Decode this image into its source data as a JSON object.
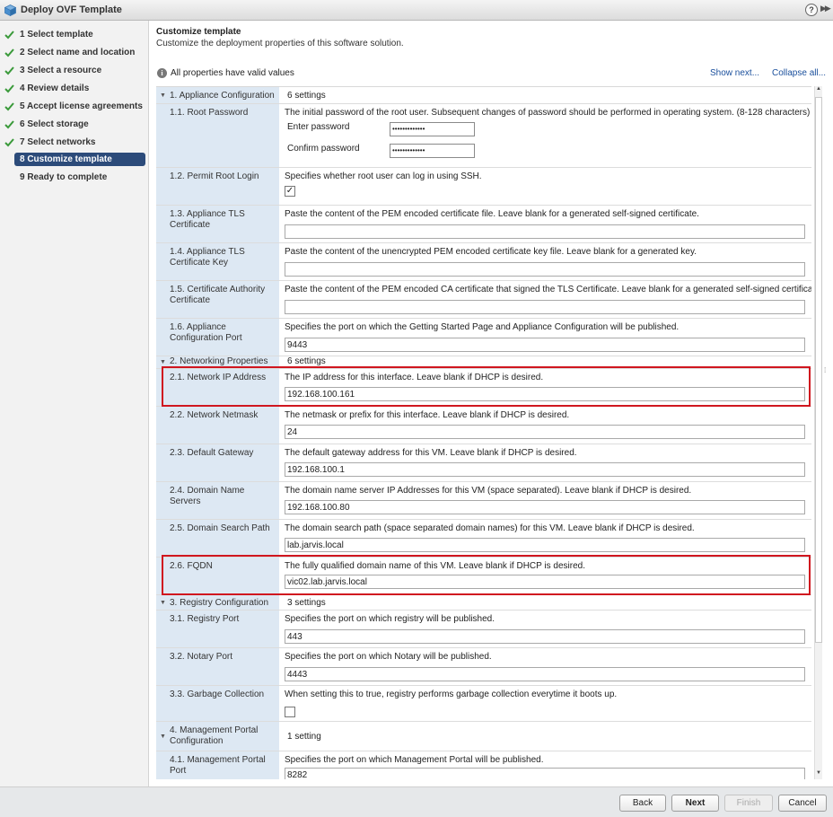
{
  "window": {
    "title": "Deploy OVF Template",
    "help": "?",
    "expand": "▶▶"
  },
  "steps": [
    {
      "label": "1  Select template",
      "done": true
    },
    {
      "label": "2  Select name and location",
      "done": true
    },
    {
      "label": "3  Select a resource",
      "done": true
    },
    {
      "label": "4  Review details",
      "done": true
    },
    {
      "label": "5  Accept license agreements",
      "done": true
    },
    {
      "label": "6  Select storage",
      "done": true
    },
    {
      "label": "7  Select networks",
      "done": true
    },
    {
      "label": "8  Customize template",
      "done": false,
      "active": true
    },
    {
      "label": "9  Ready to complete",
      "done": false
    }
  ],
  "header": {
    "title": "Customize template",
    "subtitle": "Customize the deployment properties of this software solution.",
    "valid_text": "All properties have valid values",
    "show_next": "Show next...",
    "collapse_all": "Collapse all..."
  },
  "groups": {
    "g1": {
      "label": "1. Appliance Configuration",
      "count": "6 settings"
    },
    "g2": {
      "label": "2. Networking Properties",
      "count": "6 settings"
    },
    "g3": {
      "label": "3. Registry Configuration",
      "count": "3 settings"
    },
    "g4": {
      "label": "4. Management Portal Configuration",
      "count": "1 setting"
    }
  },
  "props": {
    "root_password": {
      "label": "1.1. Root Password",
      "desc": "The initial password of the root user. Subsequent changes of password should be performed in operating system. (8-128 characters)",
      "enter_label": "Enter password",
      "confirm_label": "Confirm password",
      "enter_value": "•••••••••••••",
      "confirm_value": "•••••••••••••"
    },
    "permit_root": {
      "label": "1.2. Permit Root Login",
      "desc": "Specifies whether root user can log in using SSH.",
      "checked": "✓"
    },
    "tls_cert": {
      "label": "1.3. Appliance TLS Certificate",
      "desc": "Paste the content of the PEM encoded certificate file. Leave blank for a generated self-signed certificate.",
      "value": ""
    },
    "tls_key": {
      "label": "1.4. Appliance TLS Certificate Key",
      "desc": "Paste the content of the unencrypted PEM encoded certificate key file. Leave blank for a generated key.",
      "value": ""
    },
    "ca_cert": {
      "label": "1.5. Certificate Authority Certificate",
      "desc": "Paste the content of the PEM encoded CA certificate that signed the TLS Certificate. Leave blank for a generated self-signed certificate.",
      "value": ""
    },
    "config_port": {
      "label": "1.6. Appliance Configuration Port",
      "desc": "Specifies the port on which the Getting Started Page and Appliance Configuration will be published.",
      "value": "9443"
    },
    "ip": {
      "label": "2.1. Network IP Address",
      "desc": "The IP address for this interface. Leave blank if DHCP is desired.",
      "value": "192.168.100.161"
    },
    "netmask": {
      "label": "2.2. Network Netmask",
      "desc": "The netmask or prefix for this interface. Leave blank if DHCP is desired.",
      "value": "24"
    },
    "gateway": {
      "label": "2.3. Default Gateway",
      "desc": "The default gateway address for this VM. Leave blank if DHCP is desired.",
      "value": "192.168.100.1"
    },
    "dns": {
      "label": "2.4. Domain Name Servers",
      "desc": "The domain name server IP Addresses for this VM (space separated). Leave blank if DHCP is desired.",
      "value": "192.168.100.80"
    },
    "search": {
      "label": "2.5. Domain Search Path",
      "desc": "The domain search path (space separated domain names) for this VM. Leave blank if DHCP is desired.",
      "value": "lab.jarvis.local"
    },
    "fqdn": {
      "label": "2.6. FQDN",
      "desc": "The fully qualified domain name of this VM. Leave blank if DHCP is desired.",
      "value": "vic02.lab.jarvis.local"
    },
    "registry_port": {
      "label": "3.1. Registry Port",
      "desc": "Specifies the port on which registry will be published.",
      "value": "443"
    },
    "notary_port": {
      "label": "3.2. Notary Port",
      "desc": "Specifies the port on which Notary will be published.",
      "value": "4443"
    },
    "gc": {
      "label": "3.3. Garbage Collection",
      "desc": "When setting this to true, registry performs garbage collection everytime it boots up.",
      "checked": ""
    },
    "mgmt_port": {
      "label": "4.1. Management Portal Port",
      "desc": "Specifies the port on which Management Portal will be published.",
      "value": "8282"
    }
  },
  "footer": {
    "back": "Back",
    "next": "Next",
    "finish": "Finish",
    "cancel": "Cancel"
  },
  "colors": {
    "accent": "#2c4b7a",
    "highlight": "#d0161f",
    "label_bg": "#dde8f3",
    "check": "#3a9a3a"
  }
}
